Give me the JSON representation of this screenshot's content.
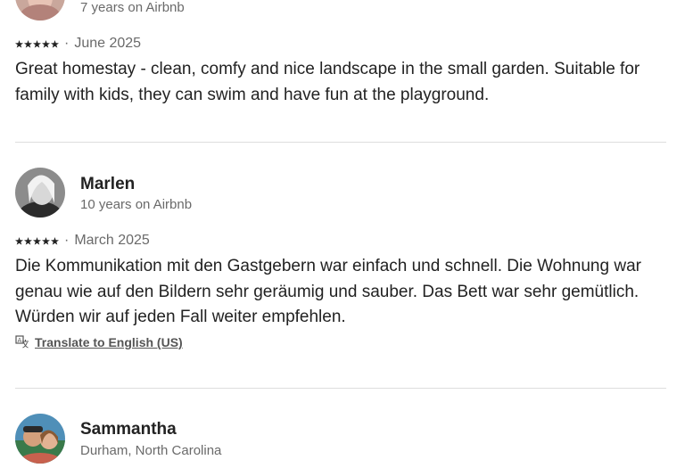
{
  "reviews": [
    {
      "meta": "7 years on Airbnb",
      "rating": 5,
      "date": "June 2025",
      "text": "Great homestay - clean, comfy and  nice landscape in the small garden. Suitable for family with kids, they can swim and have fun at the playground."
    },
    {
      "name": "Marlen",
      "meta": "10 years on Airbnb",
      "rating": 5,
      "date": "March 2025",
      "text": "Die Kommunikation mit den Gastgebern war einfach und schnell. Die Wohnung war genau wie auf den Bildern  sehr geräumig und sauber. Das Bett war sehr gemütlich. Würden wir auf jeden Fall weiter empfehlen.",
      "translate_label": "Translate to English (US)",
      "translate_icon": "translate-icon"
    },
    {
      "name": "Sammantha",
      "meta": "Durham, North Carolina"
    }
  ],
  "separator": "·",
  "colors": {
    "text": "#222222",
    "muted": "#6a6a6a",
    "divider": "#dddddd"
  }
}
